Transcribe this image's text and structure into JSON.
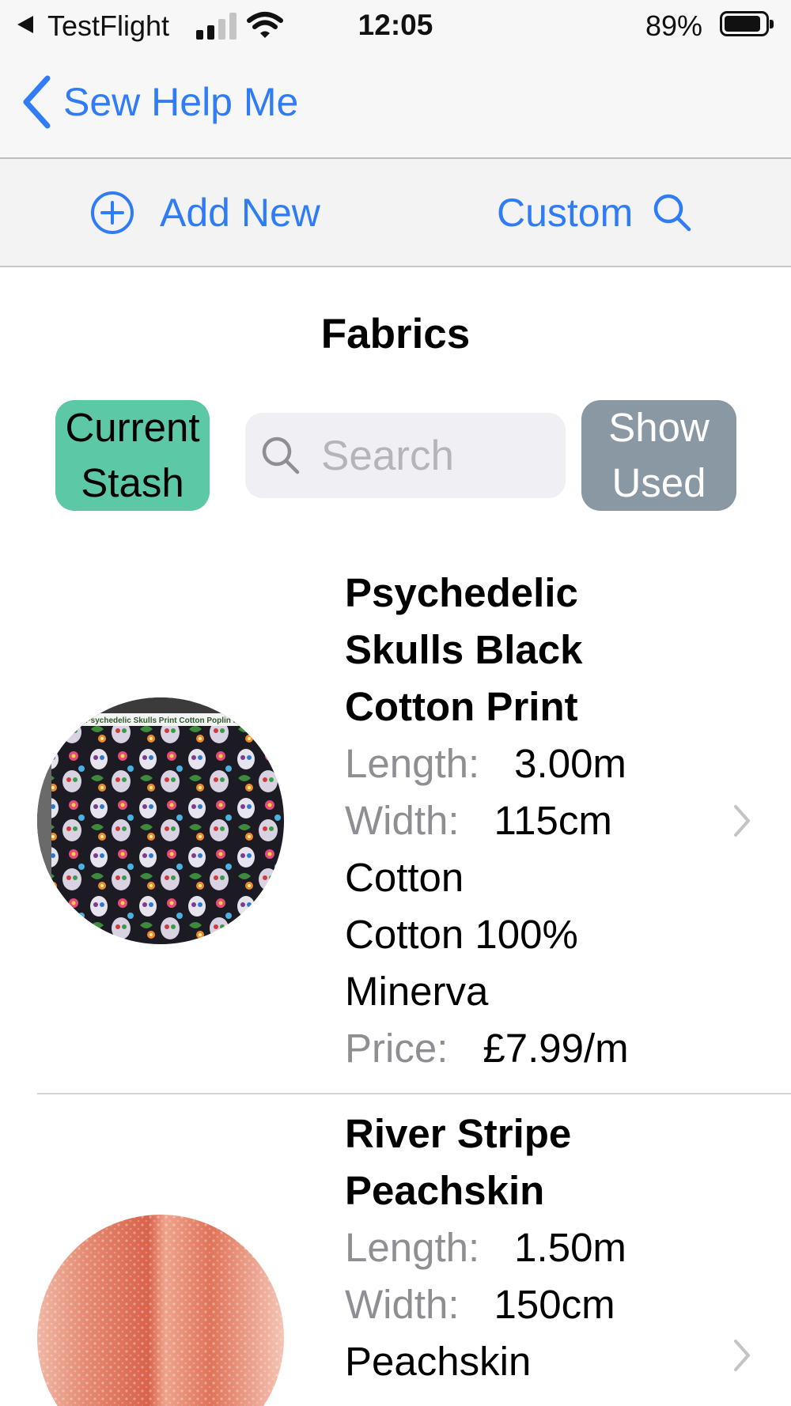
{
  "status_bar": {
    "back_app": "TestFlight",
    "time": "12:05",
    "battery_percent": "89%",
    "battery_level": 0.89,
    "signal_bars_active": 2,
    "signal_bars_total": 4
  },
  "nav": {
    "back_label": "Sew Help Me",
    "back_icon": "chevron-left-icon"
  },
  "toolbar": {
    "add_label": "Add New",
    "add_icon": "plus-circle-icon",
    "custom_label": "Custom",
    "custom_icon": "search-icon"
  },
  "page": {
    "title": "Fabrics"
  },
  "filters": {
    "current_stash_line1": "Current",
    "current_stash_line2": "Stash",
    "search_placeholder": "Search",
    "show_used_line1": "Show",
    "show_used_line2": "Used"
  },
  "labels": {
    "length": "Length:",
    "width": "Width:",
    "price": "Price:"
  },
  "fabrics": [
    {
      "name_lines": [
        "Psychedelic",
        "Skulls Black",
        "Cotton Print"
      ],
      "thumbnail_caption": "e Psychedelic Skulls Print Cotton Poplin Fa",
      "length": "3.00m",
      "width": "115cm",
      "type": "Cotton",
      "composition": "Cotton 100%",
      "supplier": "Minerva",
      "price": "£7.99/m"
    },
    {
      "name_lines": [
        "River Stripe",
        "Peachskin"
      ],
      "length": "1.50m",
      "width": "150cm",
      "type": "Peachskin"
    }
  ],
  "colors": {
    "accent_blue": "#2f7cf6",
    "current_stash_bg": "#5cc8a6",
    "show_used_bg": "#8a98a4",
    "secondary_label": "#8e8e93"
  }
}
